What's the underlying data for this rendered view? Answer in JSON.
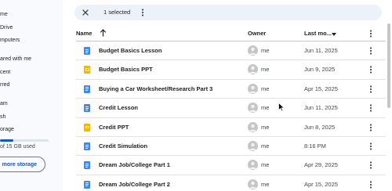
{
  "sidebar": {
    "items": [
      {
        "label": "me"
      },
      {
        "label": "Drive"
      },
      {
        "label": "mputers"
      },
      {
        "label": "ared with me"
      },
      {
        "label": "cent"
      },
      {
        "label": "rred"
      },
      {
        "label": "am"
      },
      {
        "label": "sh"
      },
      {
        "label": "orage"
      }
    ],
    "storage_text": "of 15 GB used",
    "storage_fraction": 0.28,
    "more_storage_label": "more storage"
  },
  "selection": {
    "count_label": "1 selected"
  },
  "columns": {
    "name": "Name",
    "owner": "Owner",
    "modified": "Last mo..."
  },
  "files": [
    {
      "name": "Budget Basics Lesson",
      "type": "doc",
      "owner": "me",
      "modified": "Jun 11, 2025"
    },
    {
      "name": "Budget Basics PPT",
      "type": "slides",
      "owner": "me",
      "modified": "Jun 9, 2025"
    },
    {
      "name": "Buying a Car Worksheet/Research Part 3",
      "type": "doc",
      "owner": "me",
      "modified": "Apr 15, 2025"
    },
    {
      "name": "Credit Lesson",
      "type": "doc",
      "owner": "me",
      "modified": "Jun 11, 2025"
    },
    {
      "name": "Credit PPT",
      "type": "slides",
      "owner": "me",
      "modified": "Jun 8, 2025"
    },
    {
      "name": "Credit Simulation",
      "type": "doc",
      "owner": "me",
      "modified": "8:16 PM"
    },
    {
      "name": "Dream Job/College Part 1",
      "type": "doc",
      "owner": "me",
      "modified": "Apr 29, 2025"
    },
    {
      "name": "Dream Job/College Part 2",
      "type": "doc",
      "owner": "me",
      "modified": "Apr 15, 2025"
    }
  ],
  "colors": {
    "doc": "#4285f4",
    "slides": "#f4b400",
    "accent": "#0b57d0"
  },
  "icons": {
    "close": "close-icon",
    "more": "more-vert-icon",
    "sort": "arrow-up-icon",
    "sort_dir": "caret-down-icon",
    "avatar": "person-icon"
  }
}
